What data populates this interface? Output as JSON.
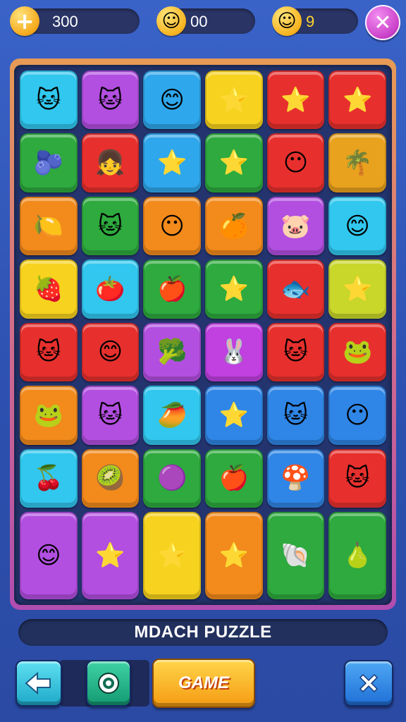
{
  "hud": {
    "coins": "300",
    "smiles": "00",
    "level": "9"
  },
  "title": "MDACH PUZZLE",
  "buttons": {
    "back_icon": "arrow-left-icon",
    "target_icon": "target-icon",
    "game_label": "GAME",
    "close_icon": "close-icon"
  },
  "board": {
    "tiles": [
      {
        "color": "#31c7ee",
        "glyph": "🐱"
      },
      {
        "color": "#b24fe0",
        "glyph": "🐱"
      },
      {
        "color": "#2fa7ec",
        "glyph": "😊"
      },
      {
        "color": "#f7d21e",
        "glyph": "⭐"
      },
      {
        "color": "#e7302d",
        "glyph": "⭐"
      },
      {
        "color": "#e7302d",
        "glyph": "⭐"
      },
      {
        "color": "#2eaa3e",
        "glyph": "🫐"
      },
      {
        "color": "#e7302d",
        "glyph": "👧"
      },
      {
        "color": "#2fa7ec",
        "glyph": "⭐"
      },
      {
        "color": "#2eaa3e",
        "glyph": "⭐"
      },
      {
        "color": "#e7302d",
        "glyph": "😶"
      },
      {
        "color": "#e8a21e",
        "glyph": "🌴"
      },
      {
        "color": "#f28a1c",
        "glyph": "🍋"
      },
      {
        "color": "#2eaa3e",
        "glyph": "🐱"
      },
      {
        "color": "#f28a1c",
        "glyph": "😶"
      },
      {
        "color": "#f28a1c",
        "glyph": "🍊"
      },
      {
        "color": "#b24fe0",
        "glyph": "🐷"
      },
      {
        "color": "#31c7ee",
        "glyph": "😊"
      },
      {
        "color": "#f7d21e",
        "glyph": "🍓"
      },
      {
        "color": "#31c7ee",
        "glyph": "🍅"
      },
      {
        "color": "#2eaa3e",
        "glyph": "🍎"
      },
      {
        "color": "#2eaa3e",
        "glyph": "⭐"
      },
      {
        "color": "#e7302d",
        "glyph": "🐟"
      },
      {
        "color": "#c9d62a",
        "glyph": "⭐"
      },
      {
        "color": "#e7302d",
        "glyph": "🐱"
      },
      {
        "color": "#e7302d",
        "glyph": "😊"
      },
      {
        "color": "#b24fe0",
        "glyph": "🥦"
      },
      {
        "color": "#c040e0",
        "glyph": "🐰"
      },
      {
        "color": "#e7302d",
        "glyph": "🐱"
      },
      {
        "color": "#e7302d",
        "glyph": "🐸"
      },
      {
        "color": "#f28a1c",
        "glyph": "🐸"
      },
      {
        "color": "#b24fe0",
        "glyph": "🐱"
      },
      {
        "color": "#31c7ee",
        "glyph": "🥭"
      },
      {
        "color": "#2f86e6",
        "glyph": "⭐"
      },
      {
        "color": "#2f86e6",
        "glyph": "🐱"
      },
      {
        "color": "#2f86e6",
        "glyph": "😶"
      },
      {
        "color": "#31c7ee",
        "glyph": "🍒"
      },
      {
        "color": "#f28a1c",
        "glyph": "🥝"
      },
      {
        "color": "#2eaa3e",
        "glyph": "🟣"
      },
      {
        "color": "#2eaa3e",
        "glyph": "🍎"
      },
      {
        "color": "#2f86e6",
        "glyph": "🍄"
      },
      {
        "color": "#e7302d",
        "glyph": "🐱"
      }
    ]
  }
}
